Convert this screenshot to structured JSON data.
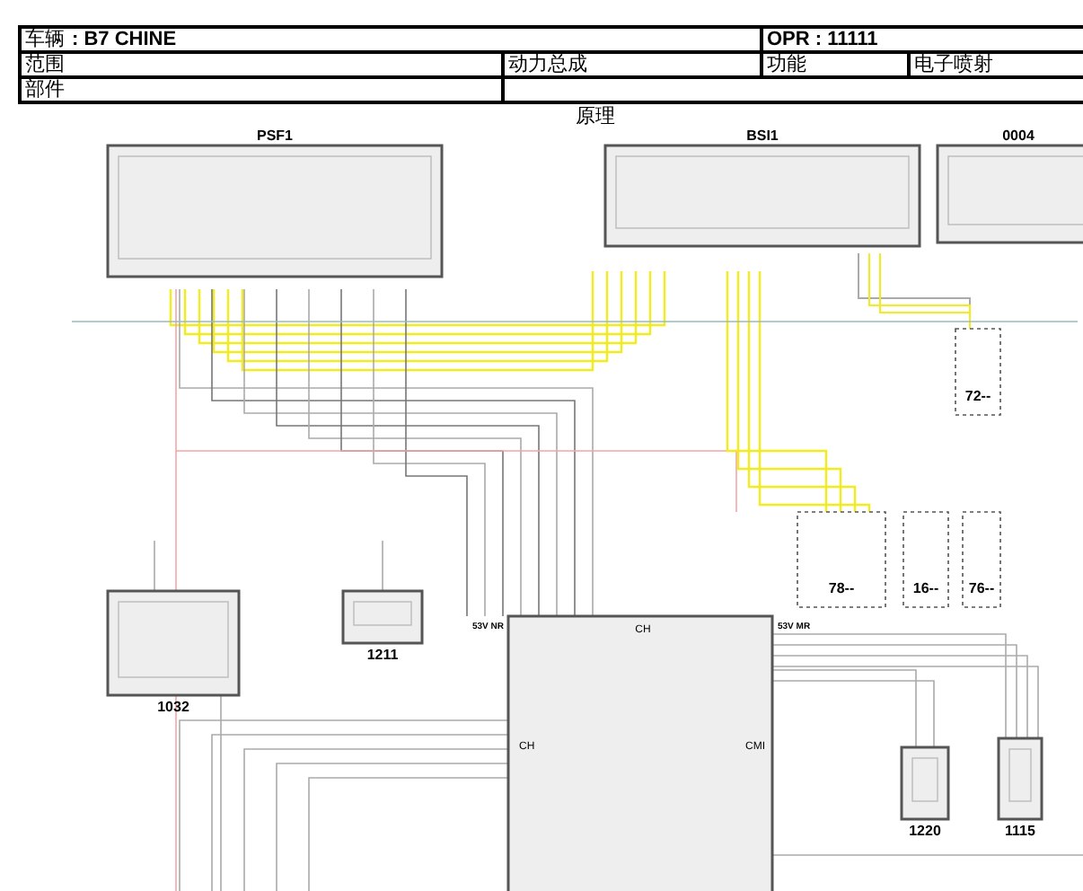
{
  "header": {
    "vehicle_label": "车辆",
    "vehicle_value": ": B7 CHINE",
    "opr_label": "OPR",
    "opr_value": ": 11111",
    "scope_label": "范围",
    "scope_value": "动力总成",
    "function_label": "功能",
    "function_value": "电子喷射",
    "part_label": "部件"
  },
  "caption": "原理",
  "components": [
    {
      "label": "PSF1",
      "kind": "module"
    },
    {
      "label": "BSI1",
      "kind": "module"
    },
    {
      "label": "0004",
      "kind": "module"
    },
    {
      "label": "72--",
      "kind": "connector"
    },
    {
      "label": "78--",
      "kind": "connector"
    },
    {
      "label": "16--",
      "kind": "connector"
    },
    {
      "label": "76--",
      "kind": "connector"
    },
    {
      "label": "1032",
      "kind": "module"
    },
    {
      "label": "1211",
      "kind": "module"
    },
    {
      "label": "1220",
      "kind": "module"
    },
    {
      "label": "1115",
      "kind": "module"
    },
    {
      "label": "CH",
      "kind": "ecu",
      "side_labels": [
        "CH",
        "CMI"
      ],
      "connector_labels": [
        "53V NR",
        "53V MR"
      ]
    }
  ]
}
